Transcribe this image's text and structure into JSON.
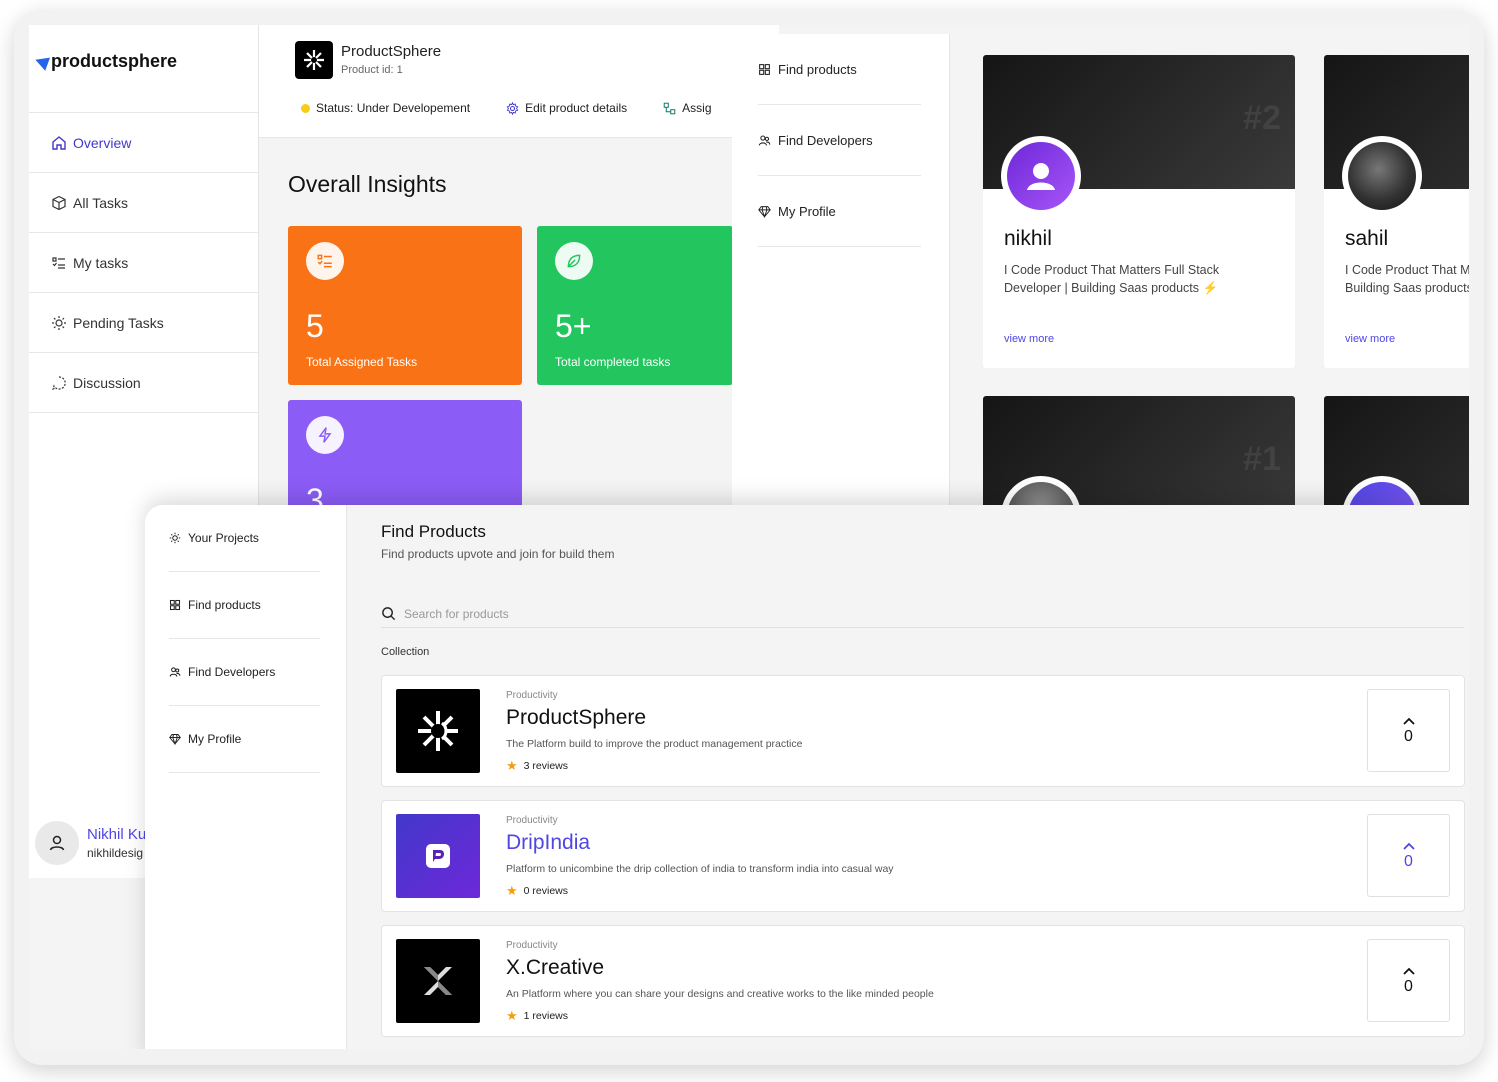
{
  "back": {
    "logo": "productsphere",
    "nav": [
      {
        "label": "Overview",
        "icon": "home-icon"
      },
      {
        "label": "All Tasks",
        "icon": "box-icon"
      },
      {
        "label": "My tasks",
        "icon": "list-icon"
      },
      {
        "label": "Pending Tasks",
        "icon": "sun-icon"
      },
      {
        "label": "Discussion",
        "icon": "chat-icon"
      }
    ],
    "user": {
      "name": "Nikhil Ku",
      "email": "nikhildesig"
    },
    "product": {
      "name": "ProductSphere",
      "id": "Product id: 1"
    },
    "meta": {
      "status": "Status: Under Developement",
      "edit": "Edit product details",
      "assign": "Assig"
    },
    "insights_title": "Overall Insights",
    "stats": [
      {
        "value": "5",
        "label": "Total Assigned Tasks",
        "color": "#f97316",
        "icon": "list-icon"
      },
      {
        "value": "5+",
        "label": "Total completed tasks",
        "color": "#22c55e",
        "icon": "leaf-icon"
      },
      {
        "value": "3",
        "label": "",
        "color": "#8b5cf6",
        "icon": "bolt-icon"
      }
    ]
  },
  "middle": {
    "nav": [
      {
        "label": "Find products",
        "icon": "grid-icon"
      },
      {
        "label": "Find Developers",
        "icon": "people-icon"
      },
      {
        "label": "My Profile",
        "icon": "diamond-icon"
      }
    ],
    "developers": [
      {
        "rank": "#2",
        "name": "nikhil",
        "bio": "I Code Product That Matters Full Stack Developer | Building Saas products",
        "more": "view more"
      },
      {
        "rank": "",
        "name": "sahil",
        "bio": "I Code Product That Matters Full Stack Developer | Building Saas products",
        "more": "view more"
      },
      {
        "rank": "#1"
      }
    ]
  },
  "front": {
    "nav": [
      {
        "label": "Your Projects",
        "icon": "sun-icon"
      },
      {
        "label": "Find products",
        "icon": "grid-icon"
      },
      {
        "label": "Find Developers",
        "icon": "people-icon"
      },
      {
        "label": "My Profile",
        "icon": "diamond-icon"
      }
    ],
    "title": "Find Products",
    "subtitle": "Find products upvote and join for build them",
    "search_placeholder": "Search for products",
    "collection_label": "Collection",
    "products": [
      {
        "category": "Productivity",
        "name": "ProductSphere",
        "desc": "The Platform build to improve the product management practice",
        "reviews": "3 reviews",
        "votes": "0",
        "name_color": "#111111"
      },
      {
        "category": "Productivity",
        "name": "DripIndia",
        "desc": "Platform to unicombine the drip collection of india to transform india into casual way",
        "reviews": "0 reviews",
        "votes": "0",
        "name_color": "#4f46e5"
      },
      {
        "category": "Productivity",
        "name": "X.Creative",
        "desc": "An Platform where you can share your designs and creative works to the like minded people",
        "reviews": "1 reviews",
        "votes": "0",
        "name_color": "#111111"
      }
    ]
  }
}
